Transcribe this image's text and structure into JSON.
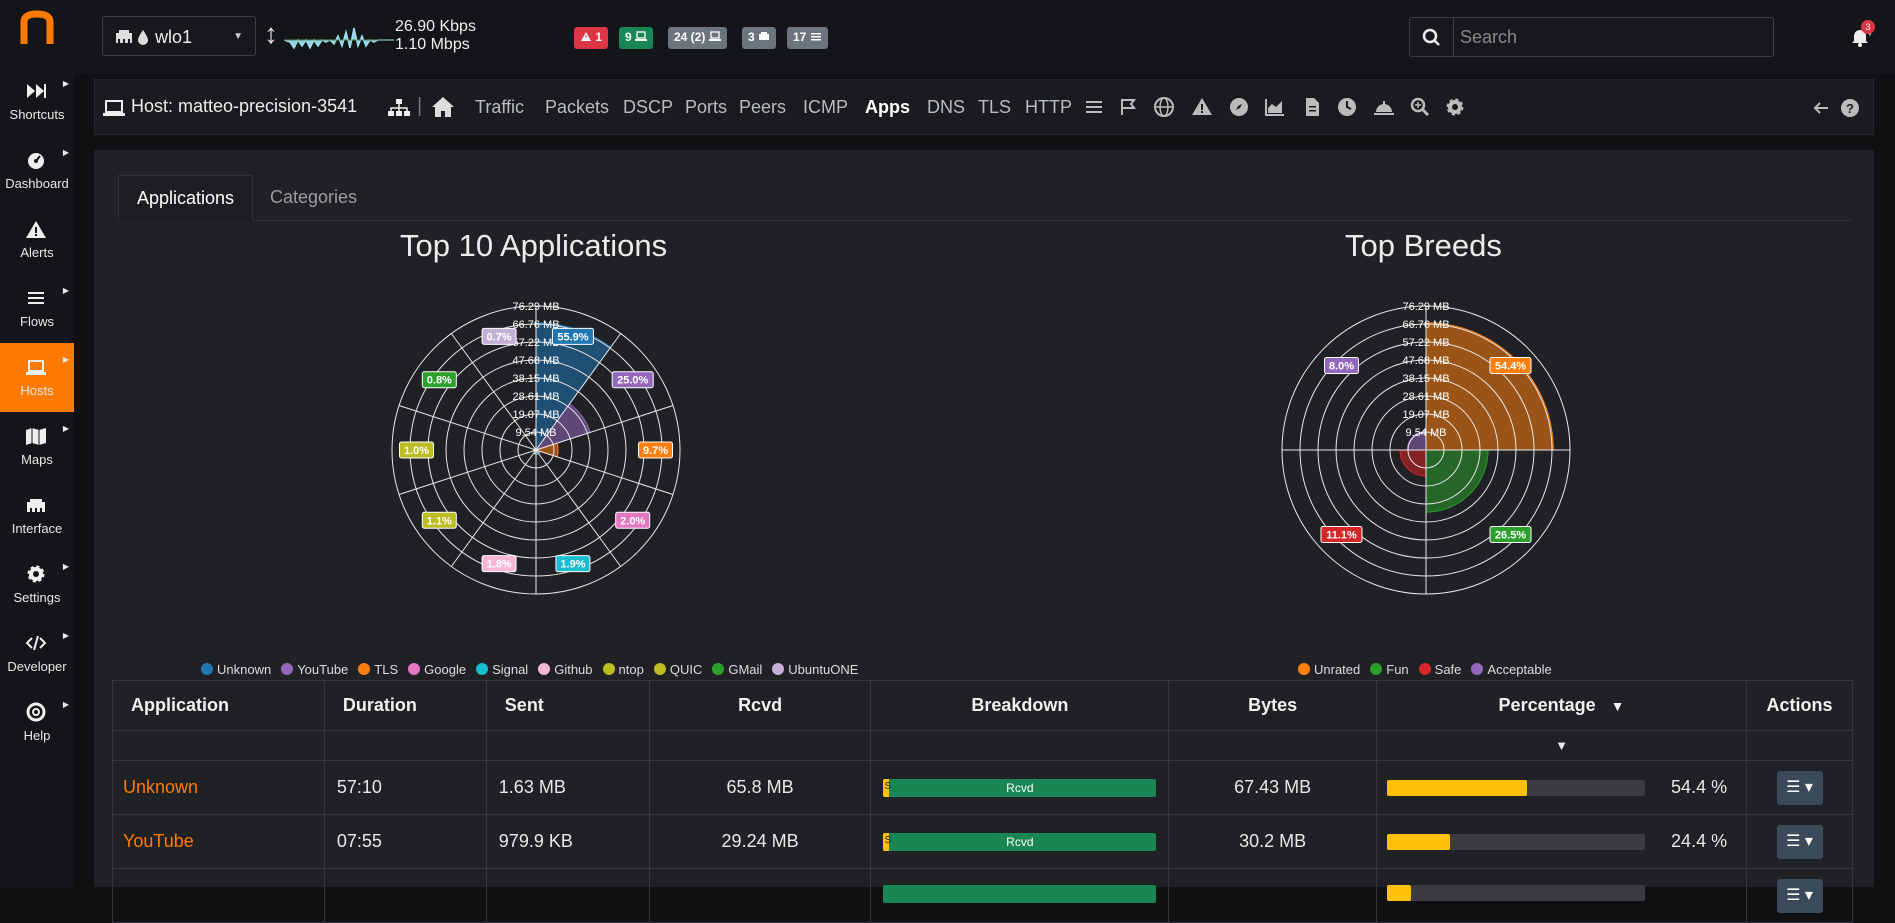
{
  "sidebar": {
    "items": [
      {
        "label": "Shortcuts",
        "icon": "fast-forward-icon"
      },
      {
        "label": "Dashboard",
        "icon": "dashboard-gauge-icon"
      },
      {
        "label": "Alerts",
        "icon": "warning-icon"
      },
      {
        "label": "Flows",
        "icon": "list-icon"
      },
      {
        "label": "Hosts",
        "icon": "laptop-icon",
        "active": true
      },
      {
        "label": "Maps",
        "icon": "map-icon"
      },
      {
        "label": "Interface",
        "icon": "ethernet-icon"
      },
      {
        "label": "Settings",
        "icon": "gear-icon"
      },
      {
        "label": "Developer",
        "icon": "code-icon"
      },
      {
        "label": "Help",
        "icon": "lifebuoy-icon"
      }
    ]
  },
  "topbar": {
    "interface": "wlo1",
    "throughput_up": "26.90 Kbps",
    "throughput_down": "1.10 Mbps",
    "badges": [
      {
        "text": "1",
        "color": "#dc3545",
        "icon": "warning-icon"
      },
      {
        "text": "9",
        "color": "#198754",
        "icon": "laptop-icon"
      },
      {
        "text": "24 (2)",
        "color": "#6c757d",
        "icon": "laptop-icon"
      },
      {
        "text": "3",
        "color": "#6c757d",
        "icon": "ethernet-icon"
      },
      {
        "text": "17",
        "color": "#6c757d",
        "icon": "list-icon"
      }
    ],
    "search_placeholder": "Search",
    "notification_count": "3"
  },
  "hostbar": {
    "host_label": "Host: matteo-precision-3541",
    "links": [
      "Traffic",
      "Packets",
      "DSCP",
      "Ports",
      "Peers",
      "ICMP",
      "Apps",
      "DNS",
      "TLS",
      "HTTP"
    ],
    "active_link": "Apps"
  },
  "tabs": {
    "applications": "Applications",
    "categories": "Categories"
  },
  "colors": {
    "accent": "#ff7a00",
    "unknown": "#1f77b4",
    "youtube": "#9467bd",
    "tls": "#ff7f0e",
    "google": "#e377c2",
    "signal": "#17becf",
    "github": "#f7b6d2",
    "ntop": "#bcbd22",
    "quic": "#bcbd22",
    "gmail": "#2ca02c",
    "ubuntuone": "#c5b0d5"
  },
  "chart_data": [
    {
      "type": "polar-area",
      "title": "Top 10 Applications",
      "radial_ticks": [
        "76.29 MB",
        "66.76 MB",
        "57.22 MB",
        "47.68 MB",
        "38.15 MB",
        "28.61 MB",
        "19.07 MB",
        "9.54 MB"
      ],
      "rmax": 76.29,
      "series": [
        {
          "name": "Unknown",
          "percent": 55.9,
          "value_mb": 67.43,
          "label": "55.9%"
        },
        {
          "name": "YouTube",
          "percent": 25.0,
          "value_mb": 30.2,
          "label": "25.0%"
        },
        {
          "name": "TLS",
          "percent": 9.7,
          "value_mb": 11.7,
          "label": "9.7%"
        },
        {
          "name": "Google",
          "percent": 2.0,
          "value_mb": 2.4,
          "label": "2.0%"
        },
        {
          "name": "Signal",
          "percent": 1.9,
          "value_mb": 2.3,
          "label": "1.9%"
        },
        {
          "name": "Github",
          "percent": 1.8,
          "value_mb": 2.2,
          "label": "1.8%"
        },
        {
          "name": "ntop",
          "percent": 1.1,
          "value_mb": 1.3,
          "label": "1.1%"
        },
        {
          "name": "QUIC",
          "percent": 1.0,
          "value_mb": 1.2,
          "label": "1.0%"
        },
        {
          "name": "GMail",
          "percent": 0.8,
          "value_mb": 1.0,
          "label": "0.8%"
        },
        {
          "name": "UbuntuONE",
          "percent": 0.7,
          "value_mb": 0.8,
          "label": "0.7%"
        }
      ],
      "legend": [
        "Unknown",
        "YouTube",
        "TLS",
        "Google",
        "Signal",
        "Github",
        "ntop",
        "QUIC",
        "GMail",
        "UbuntuONE"
      ],
      "legend_position": "bottom"
    },
    {
      "type": "polar-area",
      "title": "Top Breeds",
      "radial_ticks": [
        "76.29 MB",
        "66.76 MB",
        "57.22 MB",
        "47.68 MB",
        "38.15 MB",
        "28.61 MB",
        "19.07 MB",
        "9.54 MB"
      ],
      "rmax": 76.29,
      "series": [
        {
          "name": "Unrated",
          "percent": 54.4,
          "value_mb": 67.43,
          "label": "54.4%"
        },
        {
          "name": "Fun",
          "percent": 26.5,
          "value_mb": 32.9,
          "label": "26.5%"
        },
        {
          "name": "Safe",
          "percent": 11.1,
          "value_mb": 13.8,
          "label": "11.1%"
        },
        {
          "name": "Acceptable",
          "percent": 8.0,
          "value_mb": 9.9,
          "label": "8.0%"
        }
      ],
      "legend": [
        "Unrated",
        "Fun",
        "Safe",
        "Acceptable"
      ],
      "legend_position": "bottom"
    }
  ],
  "breeds_colors": [
    "#ff7f0e",
    "#2ca02c",
    "#d62728",
    "#9467bd"
  ],
  "table": {
    "headers": [
      "Application",
      "Duration",
      "Sent",
      "Rcvd",
      "Breakdown",
      "Bytes",
      "Percentage",
      "Actions"
    ],
    "sort_indicator": "▼",
    "rows": [
      {
        "application": "Unknown",
        "duration": "57:10",
        "sent": "1.63 MB",
        "rcvd": "65.8 MB",
        "sent_fraction": 0.024,
        "breakdown_label": "Rcvd",
        "sent_label": "S",
        "bytes": "67.43 MB",
        "percentage": "54.4 %",
        "percentage_value": 54.4
      },
      {
        "application": "YouTube",
        "duration": "07:55",
        "sent": "979.9 KB",
        "rcvd": "29.24 MB",
        "sent_fraction": 0.032,
        "breakdown_label": "Rcvd",
        "sent_label": "S",
        "bytes": "30.2 MB",
        "percentage": "24.4 %",
        "percentage_value": 24.4
      }
    ],
    "partial_row_percentage_value": 9.4
  }
}
